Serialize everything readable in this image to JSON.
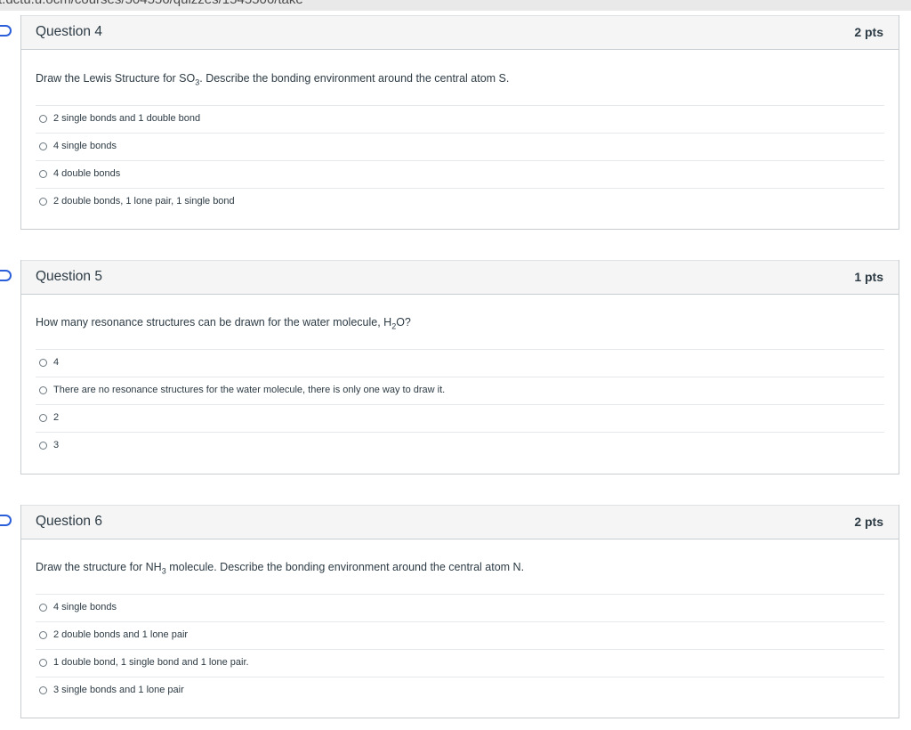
{
  "browser": {
    "url_fragment": "t.dctu.u.ocm/courses/504556/quizzes/1545506/take"
  },
  "questions": [
    {
      "title": "Question 4",
      "points": "2 pts",
      "prompt_before": "Draw the Lewis Structure for SO",
      "prompt_sub": "3",
      "prompt_after": ". Describe the bonding environment around the central atom S.",
      "answers": [
        "2 single bonds and 1 double bond",
        "4 single bonds",
        "4 double bonds",
        "2 double bonds, 1 lone pair, 1 single bond"
      ]
    },
    {
      "title": "Question 5",
      "points": "1 pts",
      "prompt_before": "How many resonance structures can be drawn for the water molecule, H",
      "prompt_sub": "2",
      "prompt_after": "O?",
      "answers": [
        "4",
        "There are no resonance structures for the water molecule, there is only one way to draw it.",
        "2",
        "3"
      ]
    },
    {
      "title": "Question 6",
      "points": "2 pts",
      "prompt_before": "Draw the structure for NH",
      "prompt_sub": "3",
      "prompt_after": " molecule. Describe the bonding environment around the central atom N.",
      "answers": [
        "4 single bonds",
        "2 double bonds and 1 lone pair",
        "1 double bond, 1 single bond and 1 lone pair.",
        "3 single bonds and 1 lone pair"
      ]
    }
  ]
}
